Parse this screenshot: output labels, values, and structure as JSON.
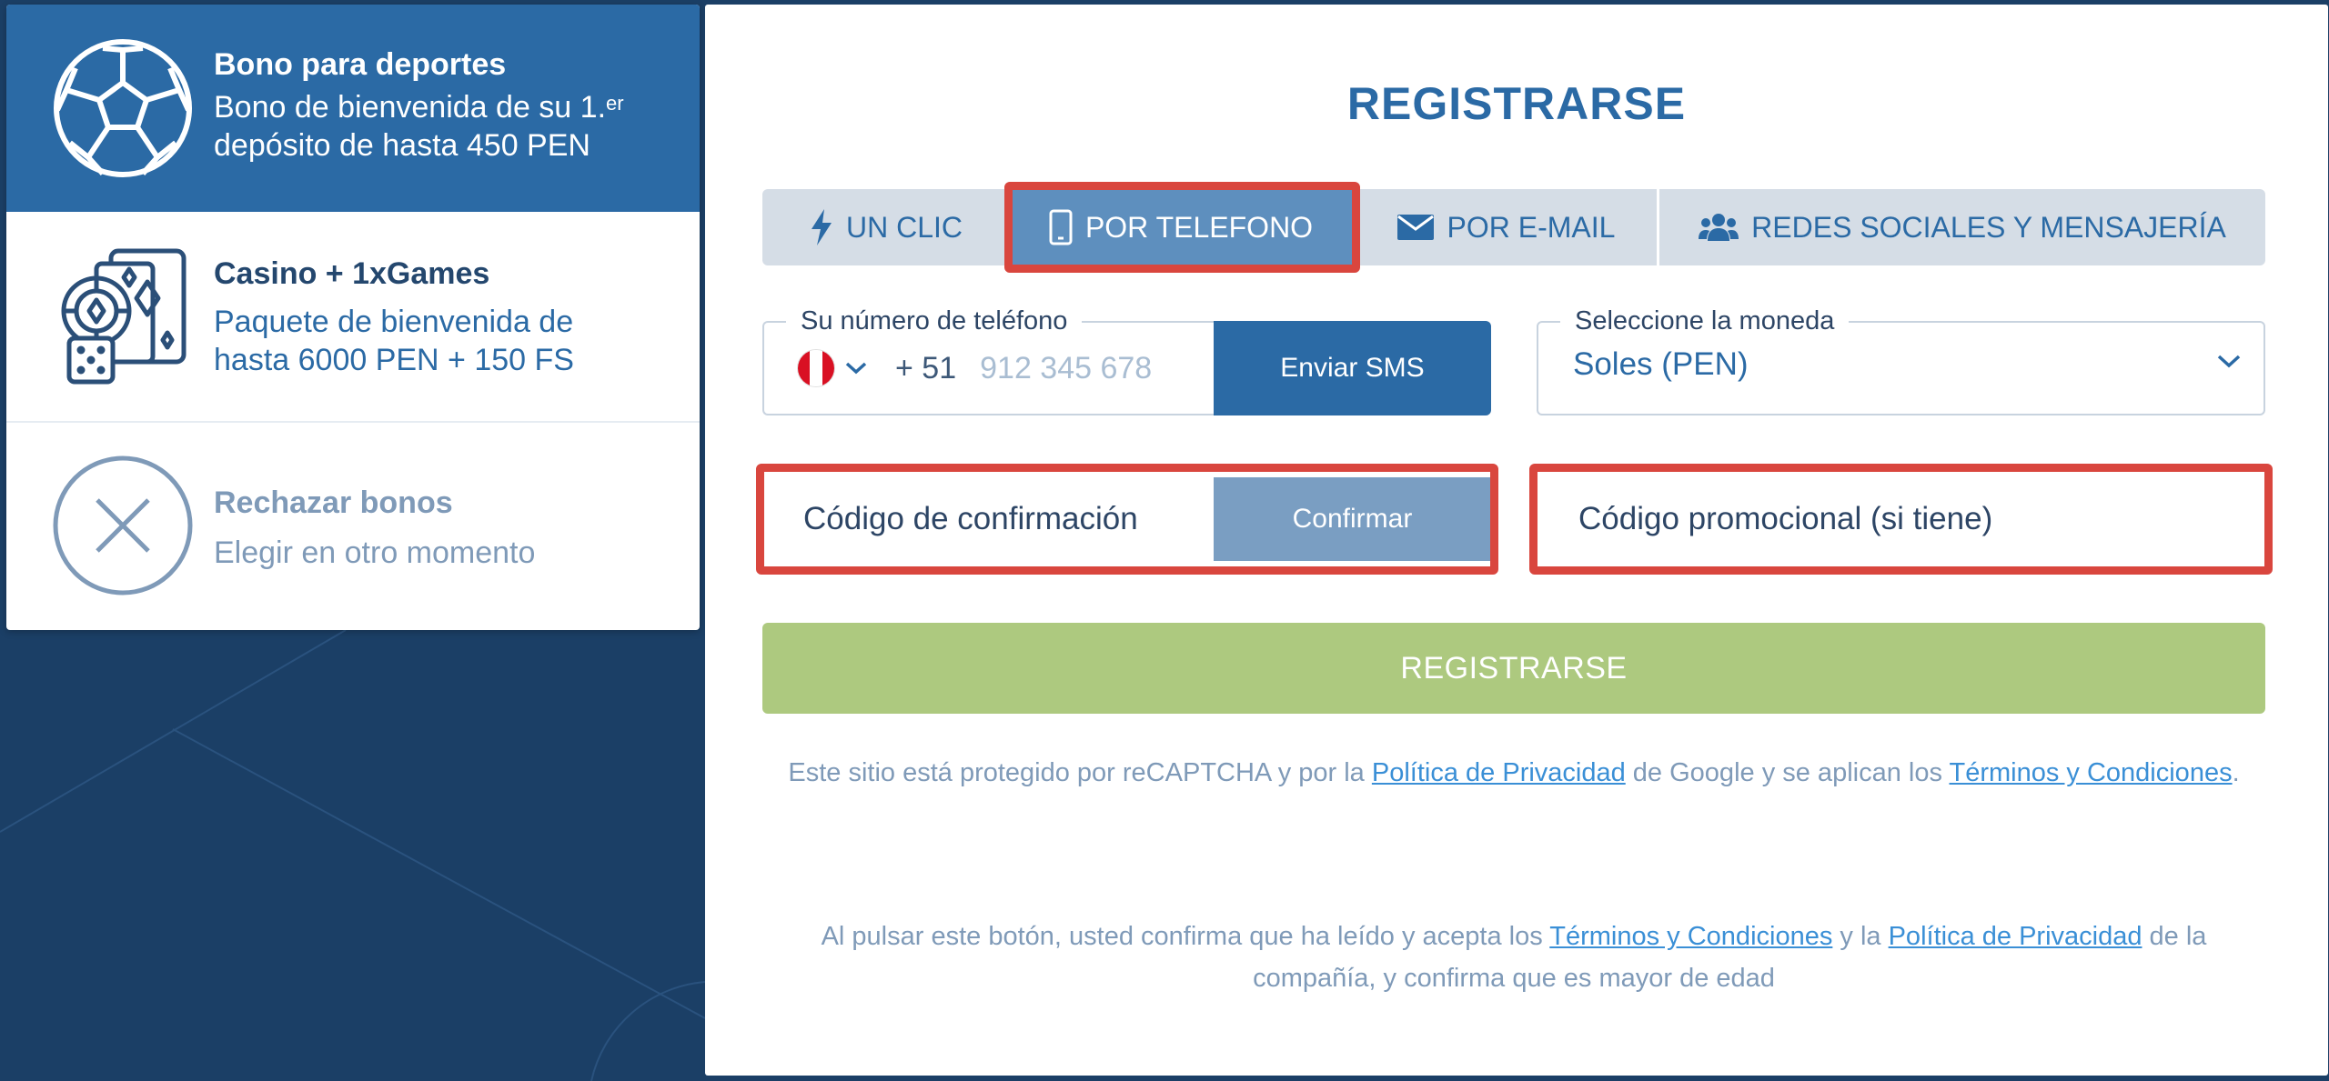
{
  "bonuses": {
    "sports": {
      "title": "Bono para deportes",
      "desc_line1": "Bono de bienvenida de su 1.",
      "desc_sup": "er",
      "desc_line2": "depósito de hasta 450 PEN"
    },
    "casino": {
      "title": "Casino + 1xGames",
      "desc_line1": "Paquete de bienvenida de",
      "desc_line2": "hasta 6000 PEN + 150 FS"
    },
    "reject": {
      "title": "Rechazar bonos",
      "desc": "Elegir en otro momento"
    }
  },
  "form": {
    "title": "REGISTRARSE",
    "tabs": [
      {
        "label": "UN CLIC",
        "icon": "lightning-icon"
      },
      {
        "label": "POR TELEFONO",
        "icon": "phone-icon",
        "active": true
      },
      {
        "label": "POR E-MAIL",
        "icon": "envelope-icon"
      },
      {
        "label": "REDES SOCIALES Y MENSAJERÍA",
        "icon": "users-icon"
      }
    ],
    "phone": {
      "legend": "Su número de teléfono",
      "prefix": "+ 51",
      "placeholder": "912 345 678",
      "send_button": "Enviar SMS"
    },
    "currency": {
      "legend": "Seleccione la moneda",
      "value": "Soles (PEN)"
    },
    "confirmation": {
      "placeholder": "Código de confirmación",
      "button": "Confirmar"
    },
    "promo": {
      "placeholder": "Código promocional (si tiene)"
    },
    "submit": "REGISTRARSE",
    "legal1": {
      "before": "Este sitio está protegido por reCAPTCHA y por la ",
      "link1": "Política de Privacidad",
      "middle": " de Google y se aplican los ",
      "link2": "Términos y Condiciones",
      "after": "."
    },
    "legal2": {
      "before": "Al pulsar este botón, usted confirma que ha leído y acepta los ",
      "link1": "Términos y Condiciones",
      "middle": " y la ",
      "link2": "Política de Privacidad",
      "after": " de la compañía, y confirma que es mayor de edad"
    }
  },
  "colors": {
    "brand_blue": "#2b6aa5",
    "active_tab": "#5e8fbe",
    "highlight": "#d9463e",
    "register_green": "#adc97f",
    "link": "#3a8fd6"
  }
}
